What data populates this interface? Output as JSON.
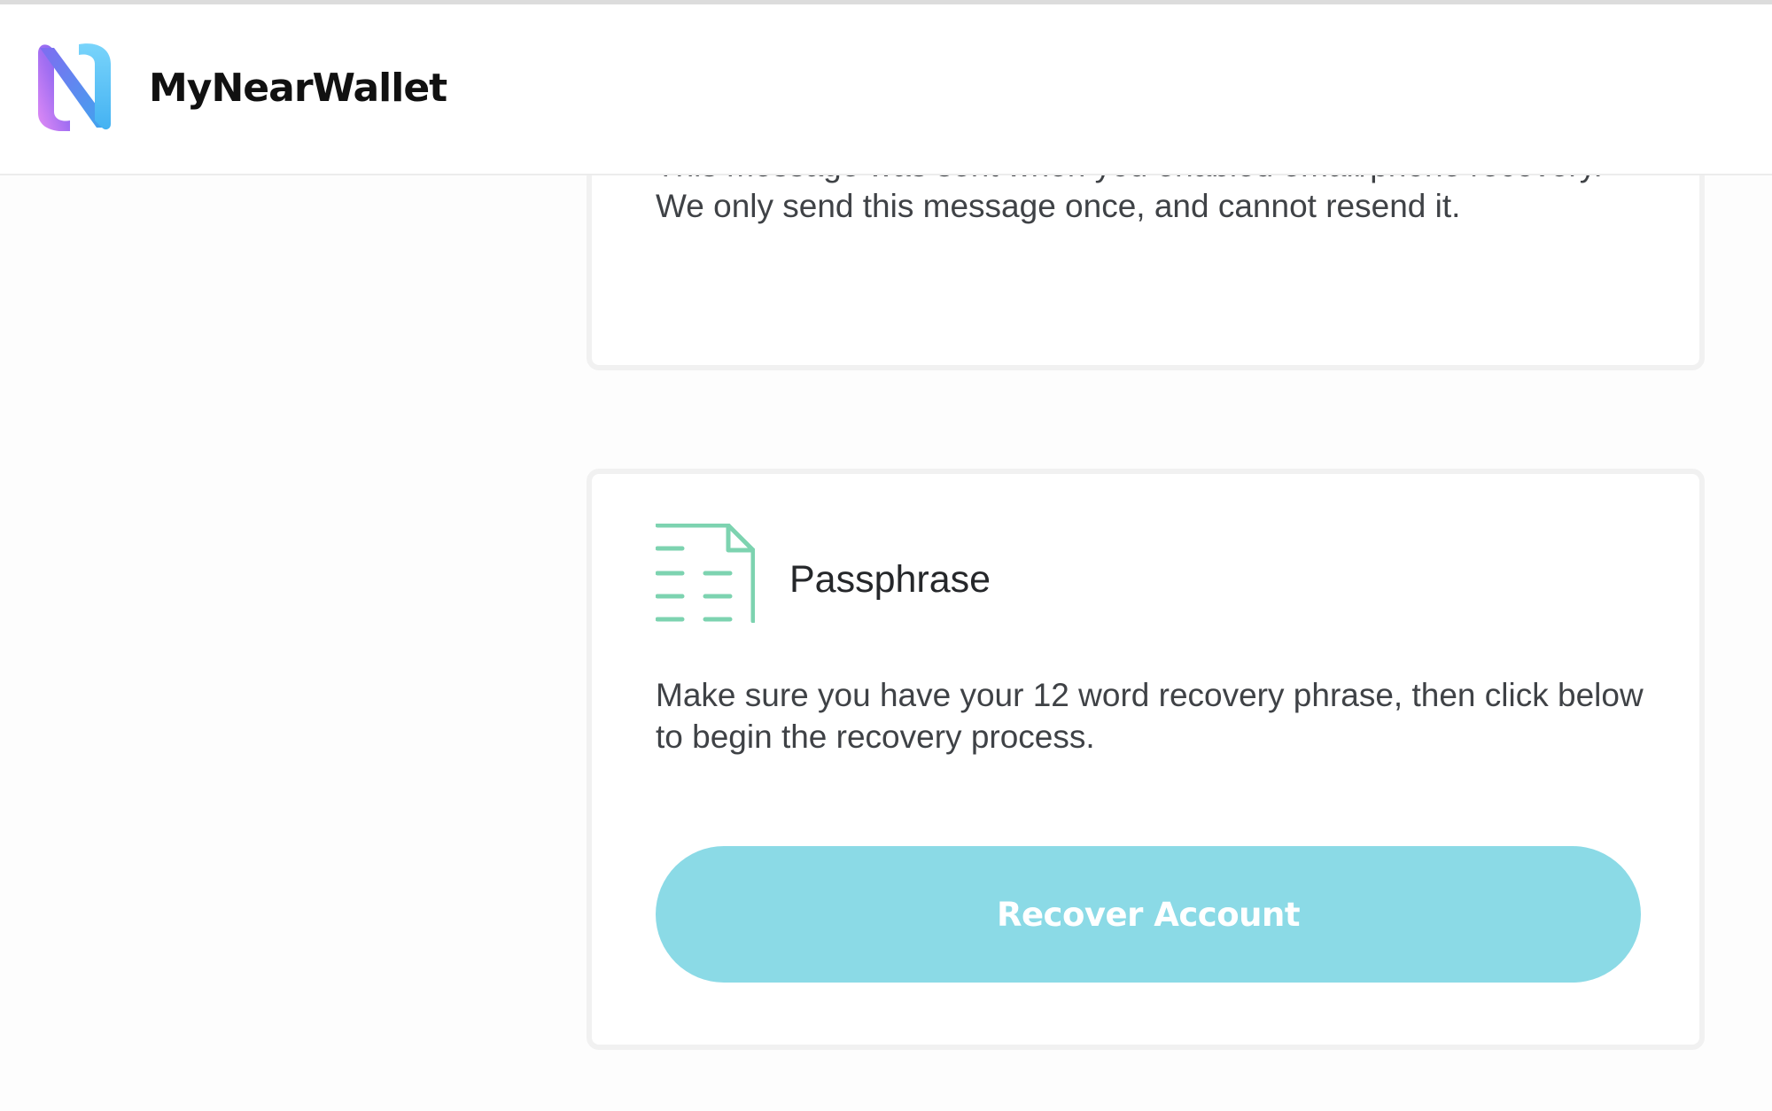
{
  "header": {
    "app_name": "MyNearWallet",
    "logo_icon": "mynearwallet-logo-icon"
  },
  "email_phone_card": {
    "description": "This message was sent when you enabled email/phone recovery. We only send this message once, and cannot resend it."
  },
  "passphrase_card": {
    "icon": "document-icon",
    "title": "Passphrase",
    "description": "Make sure you have your 12 word recovery phrase, then click below to begin the recovery process.",
    "button_label": "Recover Account"
  },
  "colors": {
    "button_bg": "#8bdae6",
    "icon_green": "#7dd3b0",
    "logo_gradient_start": "#c078f7",
    "logo_gradient_end": "#4fb6f3"
  }
}
